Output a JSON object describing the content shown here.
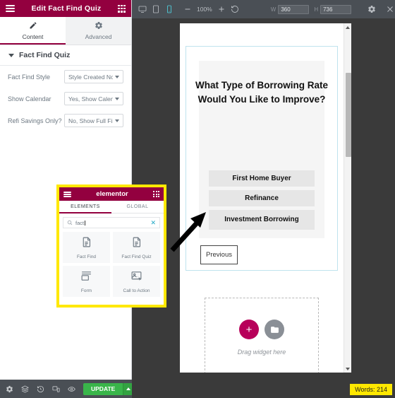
{
  "panel": {
    "header": {
      "title": "Edit Fact Find Quiz",
      "menu_icon": "hamburger-icon",
      "apps_icon": "grid-apps-icon"
    },
    "tabs": [
      {
        "label": "Content",
        "icon": "pencil-icon",
        "active": true
      },
      {
        "label": "Advanced",
        "icon": "gear-icon",
        "active": false
      }
    ],
    "section": {
      "title": "Fact Find Quiz",
      "collapse_icon": "caret-down-icon"
    },
    "controls": [
      {
        "label": "Fact Find Style",
        "value": "Style Created Nove",
        "icon": "chevron-down-icon"
      },
      {
        "label": "Show Calendar",
        "value": "Yes, Show Calenda",
        "icon": "chevron-down-icon"
      },
      {
        "label": "Refi Savings Only?",
        "value": "No, Show Full Find",
        "icon": "chevron-down-icon"
      }
    ]
  },
  "bottombar": {
    "icons": [
      "settings-gear-icon",
      "navigator-layers-icon",
      "history-clock-icon",
      "responsive-mode-icon",
      "preview-eye-icon"
    ],
    "update_label": "UPDATE",
    "update_arrow_icon": "caret-up-icon",
    "update_color": "#39b54a"
  },
  "toolbar": {
    "devices": [
      {
        "name": "desktop-view-icon",
        "active": false
      },
      {
        "name": "tablet-view-icon",
        "active": false
      },
      {
        "name": "mobile-view-icon",
        "active": true
      }
    ],
    "zoom_out_icon": "minus-icon",
    "zoom_level": "100%",
    "zoom_in_icon": "plus-icon",
    "reset_icon": "reset-rotate-icon",
    "width_key": "W",
    "width_value": "360",
    "height_key": "H",
    "height_value": "736",
    "settings_icon": "gear-icon",
    "close_icon": "close-x-icon",
    "active_color": "#50d2e0"
  },
  "canvas": {
    "quiz": {
      "question": "What Type of Borrowing Rate Would You Like to Improve?",
      "answers": [
        "First Home Buyer",
        "Refinance",
        "Investment Borrowing"
      ],
      "previous_label": "Previous"
    },
    "dropzone": {
      "text": "Drag widget here",
      "add_icon": "plus-circle-icon",
      "folder_icon": "folder-template-icon",
      "add_color": "#b7005a"
    },
    "scrollbar": {
      "up_icon": "caret-up-icon",
      "down_icon": "caret-down-icon"
    }
  },
  "popup": {
    "title": "elementor",
    "menu_icon": "hamburger-icon",
    "apps_icon": "grid-apps-icon",
    "tabs": [
      {
        "label": "ELEMENTS",
        "active": true
      },
      {
        "label": "GLOBAL",
        "active": false
      }
    ],
    "search": {
      "value": "fact",
      "icon": "search-icon",
      "clear_icon": "close-x-icon"
    },
    "widgets": [
      {
        "label": "Fact Find",
        "icon": "document-widget-icon"
      },
      {
        "label": "Fact Find Quiz",
        "icon": "document-widget-icon"
      },
      {
        "label": "Form",
        "icon": "form-widget-icon"
      },
      {
        "label": "Call to Action",
        "icon": "cta-widget-icon"
      }
    ],
    "highlight_color": "#ffe800",
    "brand_color": "#93003f"
  },
  "status": {
    "words_label": "Words: 214",
    "badge_color": "#ffe800"
  }
}
